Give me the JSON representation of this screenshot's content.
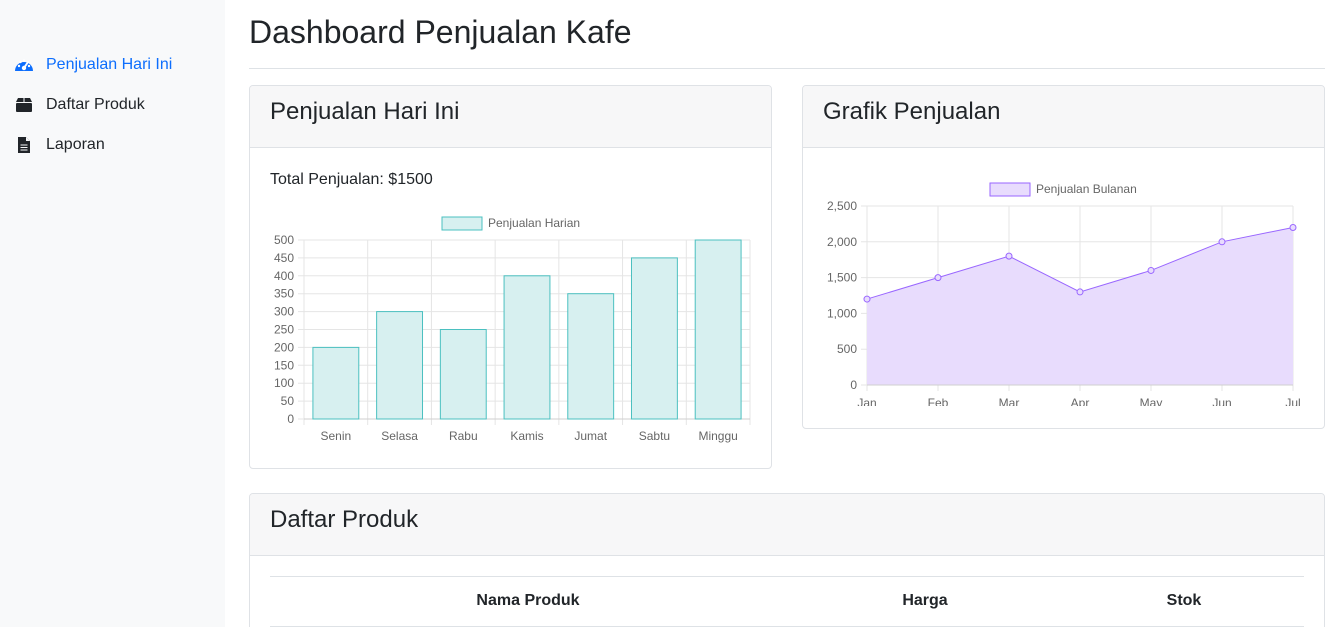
{
  "sidebar": {
    "items": [
      {
        "label": "Penjualan Hari Ini",
        "icon": "dashboard-gauge-icon",
        "active": true
      },
      {
        "label": "Daftar Produk",
        "icon": "box-icon",
        "active": false
      },
      {
        "label": "Laporan",
        "icon": "file-document-icon",
        "active": false
      }
    ]
  },
  "page": {
    "title": "Dashboard Penjualan Kafe"
  },
  "daily_card": {
    "title": "Penjualan Hari Ini",
    "total_text": "Total Penjualan: $1500"
  },
  "monthly_card": {
    "title": "Grafik Penjualan"
  },
  "products_card": {
    "title": "Daftar Produk",
    "columns": [
      "Nama Produk",
      "Harga",
      "Stok"
    ]
  },
  "colors": {
    "accent": "#0d6efd",
    "bar_fill": "#d7f0f0",
    "bar_stroke": "#4bc0c0",
    "area_fill": "#e8dcfd",
    "area_stroke": "#9966ff"
  },
  "chart_data": [
    {
      "type": "bar",
      "legend": [
        "Penjualan Harian"
      ],
      "legend_position": "top",
      "categories": [
        "Senin",
        "Selasa",
        "Rabu",
        "Kamis",
        "Jumat",
        "Sabtu",
        "Minggu"
      ],
      "series": [
        {
          "name": "Penjualan Harian",
          "values": [
            200,
            300,
            250,
            400,
            350,
            450,
            500
          ]
        }
      ],
      "ylim": [
        0,
        500
      ],
      "yticks": [
        0,
        50,
        100,
        150,
        200,
        250,
        300,
        350,
        400,
        450,
        500
      ],
      "grid": true
    },
    {
      "type": "area",
      "legend": [
        "Penjualan Bulanan"
      ],
      "legend_position": "top",
      "categories": [
        "Jan",
        "Feb",
        "Mar",
        "Apr",
        "May",
        "Jun",
        "Jul"
      ],
      "series": [
        {
          "name": "Penjualan Bulanan",
          "values": [
            1200,
            1500,
            1800,
            1300,
            1600,
            2000,
            2200
          ]
        }
      ],
      "ylim": [
        0,
        2500
      ],
      "yticks": [
        "0",
        "500",
        "1,000",
        "1,500",
        "2,000",
        "2,500"
      ],
      "grid": true
    }
  ]
}
